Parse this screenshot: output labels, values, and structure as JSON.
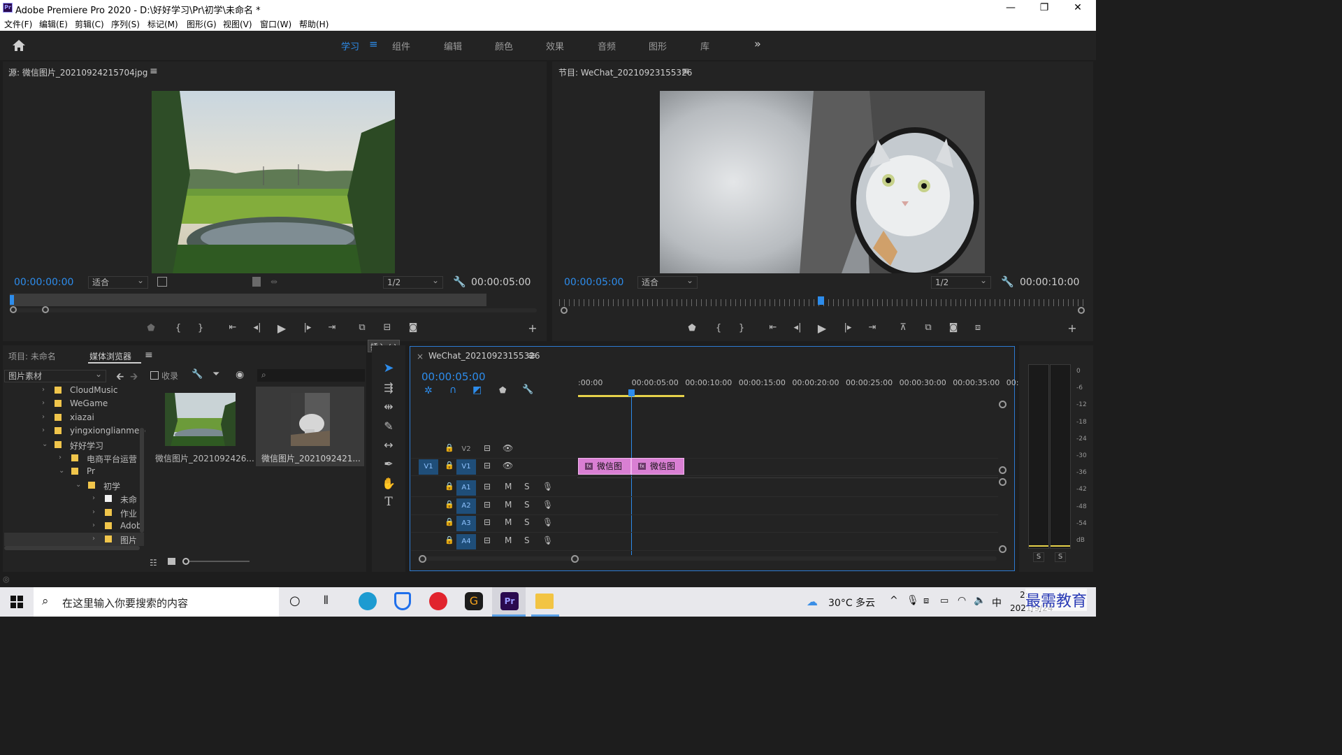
{
  "window": {
    "title": "Adobe Premiere Pro 2020 - D:\\好好学习\\Pr\\初学\\未命名 *",
    "minimize": "—",
    "maximize": "❐",
    "close": "✕"
  },
  "menu": [
    "文件(F)",
    "编辑(E)",
    "剪辑(C)",
    "序列(S)",
    "标记(M)",
    "图形(G)",
    "视图(V)",
    "窗口(W)",
    "帮助(H)"
  ],
  "workspaces": {
    "items": [
      "学习",
      "组件",
      "编辑",
      "颜色",
      "效果",
      "音频",
      "图形",
      "库"
    ],
    "active": "学习",
    "more": "»"
  },
  "source_monitor": {
    "title": "源: 微信图片_20210924215704jpg",
    "timecode": "00:00:00:00",
    "fit": "适合",
    "resolution": "1/2",
    "duration": "00:00:05:00"
  },
  "program_monitor": {
    "title": "节目: WeChat_20210923155326",
    "timecode": "00:00:05:00",
    "fit": "适合",
    "resolution": "1/2",
    "duration": "00:00:10:00"
  },
  "tooltip": "插入 (,)",
  "project_panel": {
    "tab_project": "项目: 未命名",
    "tab_media": "媒体浏览器",
    "location": "图片素材",
    "favorites": "收录",
    "search_placeholder": "",
    "tree": [
      {
        "label": "CloudMusic",
        "level": 0,
        "expanded": false
      },
      {
        "label": "WeGame",
        "level": 0,
        "expanded": false
      },
      {
        "label": "xiazai",
        "level": 0,
        "expanded": false
      },
      {
        "label": "yingxionglianmeng",
        "level": 0,
        "expanded": false
      },
      {
        "label": "好好学习",
        "level": 0,
        "expanded": true
      },
      {
        "label": "电商平台运营",
        "level": 1,
        "expanded": false
      },
      {
        "label": "Pr",
        "level": 1,
        "expanded": true
      },
      {
        "label": "初学",
        "level": 2,
        "expanded": true
      },
      {
        "label": "未命",
        "level": 3,
        "expanded": false
      },
      {
        "label": "作业",
        "level": 3,
        "expanded": false
      },
      {
        "label": "Adob",
        "level": 3,
        "expanded": false
      },
      {
        "label": "图片",
        "level": 3,
        "expanded": false
      }
    ],
    "thumbs": [
      {
        "label": "微信图片_2021092426..."
      },
      {
        "label": "微信图片_2021092421..."
      }
    ]
  },
  "timeline": {
    "sequence": "WeChat_20210923155326",
    "timecode": "00:00:05:00",
    "ruler": [
      ":00:00",
      "00:00:05:00",
      "00:00:10:00",
      "00:00:15:00",
      "00:00:20:00",
      "00:00:25:00",
      "00:00:30:00",
      "00:00:35:00",
      "00:0"
    ],
    "tracks": [
      {
        "name": "V2",
        "type": "video"
      },
      {
        "name": "V1",
        "type": "video",
        "source": "V1"
      },
      {
        "name": "A1",
        "type": "audio"
      },
      {
        "name": "A2",
        "type": "audio"
      },
      {
        "name": "A3",
        "type": "audio"
      },
      {
        "name": "A4",
        "type": "audio"
      }
    ],
    "track_letters": {
      "mute": "M",
      "solo": "S"
    },
    "clips": [
      {
        "label": "微信图"
      },
      {
        "label": "微信图"
      }
    ]
  },
  "audio_meter": {
    "scale": [
      "0",
      "-6",
      "-12",
      "-18",
      "-24",
      "-30",
      "-36",
      "-42",
      "-48",
      "-54",
      "dB"
    ],
    "solo_left": "S",
    "solo_right": "S"
  },
  "taskbar": {
    "search_placeholder": "在这里输入你要搜索的内容",
    "weather": "30°C 多云",
    "ime": "中",
    "time": "2:",
    "date": "2021/9/24",
    "watermark": "最需教育"
  }
}
